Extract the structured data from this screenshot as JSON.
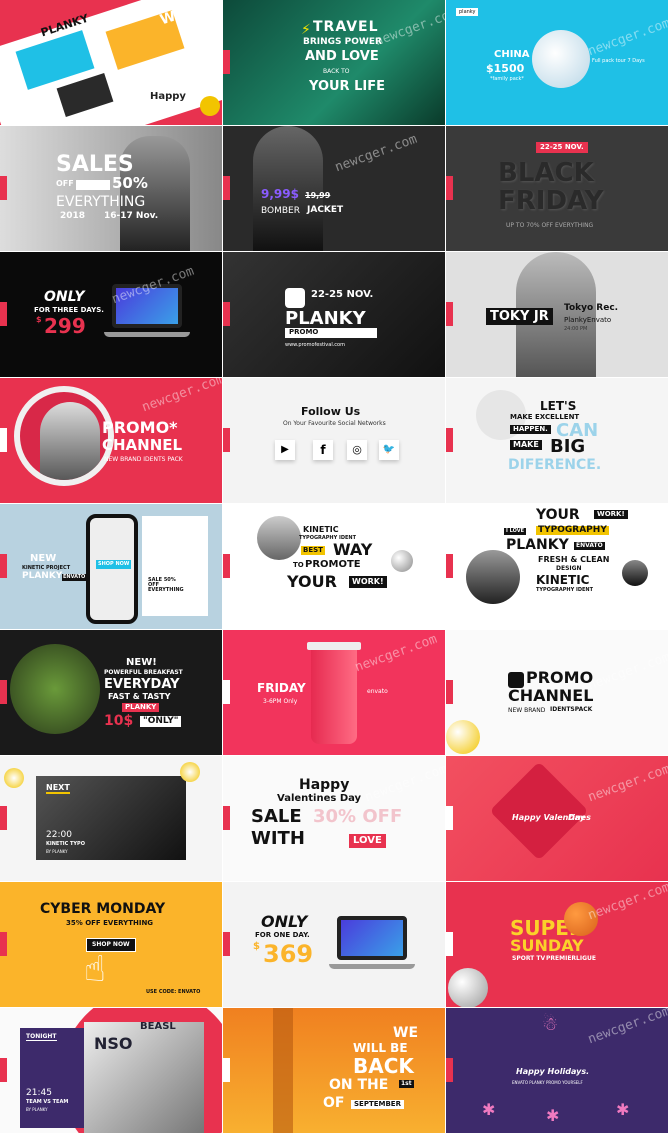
{
  "watermark": "newcger.com",
  "colors": {
    "accent": "#e8324f",
    "cyan": "#1fc0e6",
    "dark": "#2a2a2a",
    "yellow": "#fbb42a",
    "purple": "#3d2a6b"
  },
  "t01": {
    "l1": "WE",
    "l2": "PLANKY",
    "l3": "Happy"
  },
  "t02": {
    "l1": "TRAVEL",
    "l2": "BRINGS POWER",
    "l3": "AND LOVE",
    "l4": "BACK TO",
    "l5": "YOUR LIFE"
  },
  "t03": {
    "badge": "planky",
    "country": "CHINA",
    "price": "$1500",
    "note": "*family pack*",
    "tour": "Full pack tour 7 Days"
  },
  "t04": {
    "l1": "SALES",
    "off": "OFF",
    "pct": "50%",
    "every": "EVERYTHING",
    "year": "2018",
    "dates": "16-17 Nov."
  },
  "t05": {
    "price": "9,99$",
    "old": "19,99",
    "l2": "BOMBER",
    "l3": "JACKET"
  },
  "t06": {
    "badge": "22-25 NOV.",
    "l1": "BLACK",
    "l2": "FRIDAY",
    "l3": "UP TO 70% OFF EVERYTHING"
  },
  "t07": {
    "l1": "ONLY",
    "l2": "FOR THREE DAYS.",
    "price": "299",
    "cur": "$"
  },
  "t08": {
    "date": "22-25 NOV.",
    "brand": "PLANKY",
    "promo": "PROMO",
    "year": "2018",
    "url": "www.promofestival.com"
  },
  "t09": {
    "l1": "TOKY JR",
    "l2": "Tokyo Rec.",
    "l3": "PlankyEnvato",
    "l4": "24:00 PM"
  },
  "t10": {
    "l1": "PROMO*",
    "l2": "CHANNEL",
    "l3": "NEW BRAND IDENTS PACK"
  },
  "t11": {
    "l1": "Follow Us",
    "l2": "On Your Favourite Social Networks",
    "i1": "▶",
    "i2": "f",
    "i3": "◎",
    "i4": "🐦"
  },
  "t12": {
    "l1": "LET'S",
    "l2": "MAKE EXCELLENT",
    "l3": "HAPPEN.",
    "l4": "CAN",
    "l5": "MAKE",
    "l6": "BIG",
    "l7": "DIFERENCE."
  },
  "t13": {
    "l1": "NEW",
    "l2": "KINETIC PROJECT",
    "l3": "PLANKY",
    "l4": "ENVATO",
    "shop": "SHOP NOW",
    "sale": "SALE 50% OFF EVERYTHING"
  },
  "t14": {
    "l1": "KINETIC",
    "l2": "TYPOGRAPHY IDENT",
    "l3": "BEST",
    "l4": "WAY",
    "l5": "TO",
    "l6": "PROMOTE",
    "l7": "YOUR",
    "l8": "WORK!"
  },
  "t15": {
    "l1": "YOUR",
    "l2": "WORK!",
    "l3": "I LOVE",
    "l4": "TYPOGRAPHY",
    "l5": "PLANKY",
    "l6": "ENVATO",
    "l7": "FRESH & CLEAN",
    "l8": "DESIGN",
    "l9": "KINETIC",
    "l10": "TYPOGRAPHY IDENT"
  },
  "t16": {
    "l1": "NEW!",
    "l2": "POWERFUL BREAKFAST",
    "l3": "EVERYDAY",
    "l4": "FAST & TASTY",
    "l5": "PLANKY",
    "l6": "10$",
    "l7": "\"ONLY\""
  },
  "t17": {
    "l1": "FRIDAY",
    "l2": "3-6PM Only",
    "l3": "envato"
  },
  "t18": {
    "l1": "PROMO",
    "l2": "CHANNEL",
    "l3": "NEW BRAND",
    "l4": "IDENTSPACK"
  },
  "t19": {
    "l1": "NEXT",
    "l2": "22:00",
    "l3": "KINETIC TYPO",
    "l4": "BY PLANKY"
  },
  "t20": {
    "l1": "Happy",
    "l2": "Valentines Day",
    "l3": "SALE",
    "l4": "30% OFF",
    "l5": "WITH",
    "l6": "LOVE"
  },
  "t21": {
    "l1": "Happy Valentines",
    "l2": "Day"
  },
  "t22": {
    "l1": "CYBER MONDAY",
    "l2": "35% OFF EVERYTHING",
    "shop": "SHOP NOW",
    "code": "USE CODE: ENVATO"
  },
  "t23": {
    "l1": "ONLY",
    "l2": "FOR ONE DAY.",
    "price": "369",
    "cur": "$"
  },
  "t24": {
    "l1": "SUPER",
    "l2": "SUNDAY",
    "l3": "SPORT TV",
    "l4": "PREMIERLIGUE"
  },
  "t25": {
    "l1": "TONIGHT",
    "l2": "21:45",
    "l3": "TEAM VS TEAM",
    "l4": "BY PLANKY",
    "jersey": "NSO",
    "jersey2": "BEASL"
  },
  "t26": {
    "l1": "WE",
    "l2": "WILL BE",
    "l3": "BACK",
    "l4": "ON THE",
    "l5": "1st",
    "l6": "OF",
    "l7": "SEPTEMBER"
  },
  "t27": {
    "l1": "Happy Holidays.",
    "l2": "ENVATO PLANKY PROMO YOURSELF"
  }
}
